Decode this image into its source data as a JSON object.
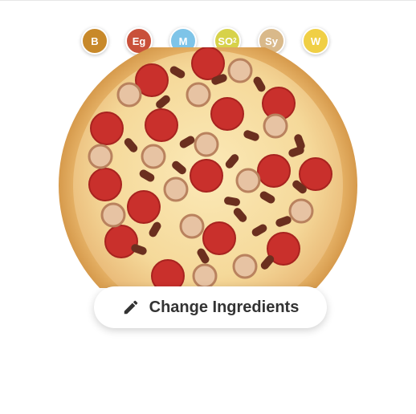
{
  "allergens": [
    {
      "code": "B",
      "sup": "",
      "color": "#c8892a",
      "icon": "allergen-b-icon"
    },
    {
      "code": "Eg",
      "sup": "",
      "color": "#c9503a",
      "icon": "allergen-egg-icon"
    },
    {
      "code": "M",
      "sup": "",
      "color": "#7ec4e8",
      "icon": "allergen-milk-icon"
    },
    {
      "code": "SO",
      "sup": "2",
      "color": "#d7d24a",
      "icon": "allergen-sulphites-icon"
    },
    {
      "code": "Sy",
      "sup": "",
      "color": "#d9b98a",
      "icon": "allergen-soy-icon"
    },
    {
      "code": "W",
      "sup": "",
      "color": "#f0cf45",
      "icon": "allergen-wheat-icon"
    }
  ],
  "product": {
    "image": "pepperoni-sausage-pizza-image"
  },
  "actions": {
    "change_ingredients_label": "Change Ingredients",
    "change_ingredients_icon": "pencil-icon"
  }
}
